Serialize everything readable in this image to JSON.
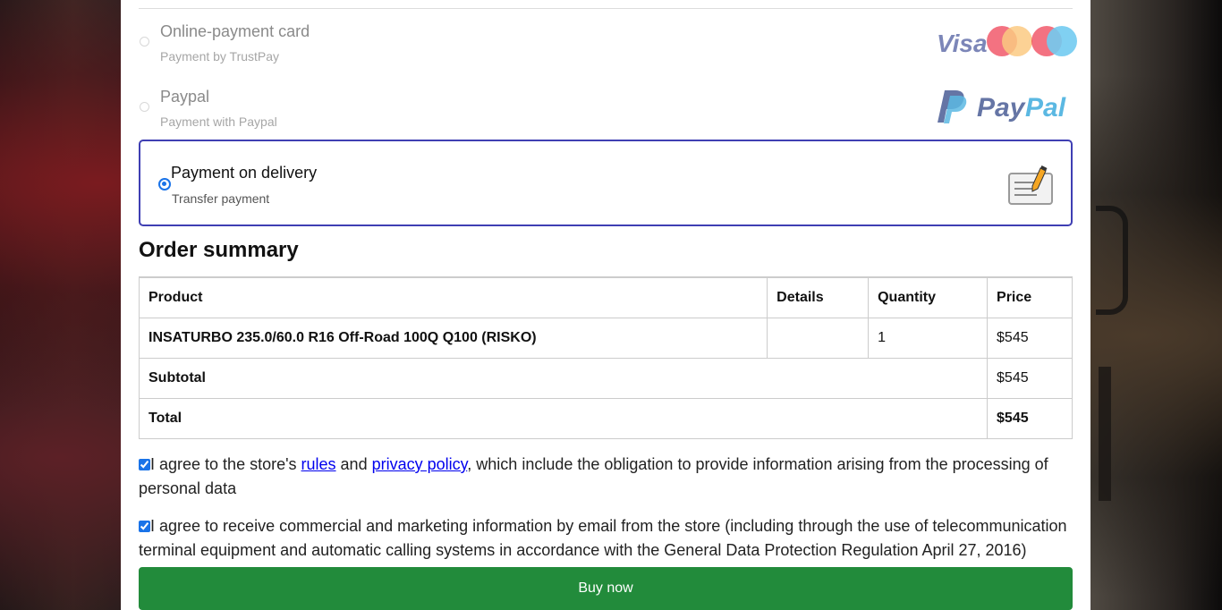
{
  "payment_methods": [
    {
      "title": "Online-payment card",
      "subtitle": "Payment by TrustPay",
      "selected": false,
      "logos": [
        "visa-logo",
        "mastercard-logo",
        "maestro-logo"
      ]
    },
    {
      "title": "Paypal",
      "subtitle": "Payment with Paypal",
      "selected": false,
      "logos": [
        "paypal-logo"
      ]
    },
    {
      "title": "Payment on delivery",
      "subtitle": "Transfer payment",
      "selected": true,
      "logos": [
        "invoice-pencil-icon"
      ]
    }
  ],
  "logos": {
    "visa": "Visa",
    "paypal": "PayPal"
  },
  "summary": {
    "heading": "Order summary",
    "columns": [
      "Product",
      "Details",
      "Quantity",
      "Price"
    ],
    "items": [
      {
        "product": "INSATURBO 235.0/60.0 R16 Off-Road 100Q Q100 (RISKO)",
        "details": "",
        "quantity": "1",
        "price": "$545"
      }
    ],
    "subtotal_label": "Subtotal",
    "subtotal": "$545",
    "total_label": "Total",
    "total": "$545"
  },
  "consents": {
    "rules": {
      "checked": true,
      "prefix": "I agree to the store's ",
      "rules_link": "rules",
      "and": " and ",
      "privacy_link": "privacy policy",
      "suffix": ", which include the obligation to provide information arising from the processing of personal data"
    },
    "marketing": {
      "checked": true,
      "text": "I agree to receive commercial and marketing information by email from the store (including through the use of telecommunication terminal equipment and automatic calling systems in accordance with the General Data Protection Regulation April 27, 2016)"
    }
  },
  "buy_button": "Buy now",
  "colors": {
    "accent_border": "#3f3fb3",
    "radio": "#1a73e8",
    "buy": "#228b3b",
    "paypal_dark": "#253b80",
    "paypal_light": "#179bd7"
  }
}
